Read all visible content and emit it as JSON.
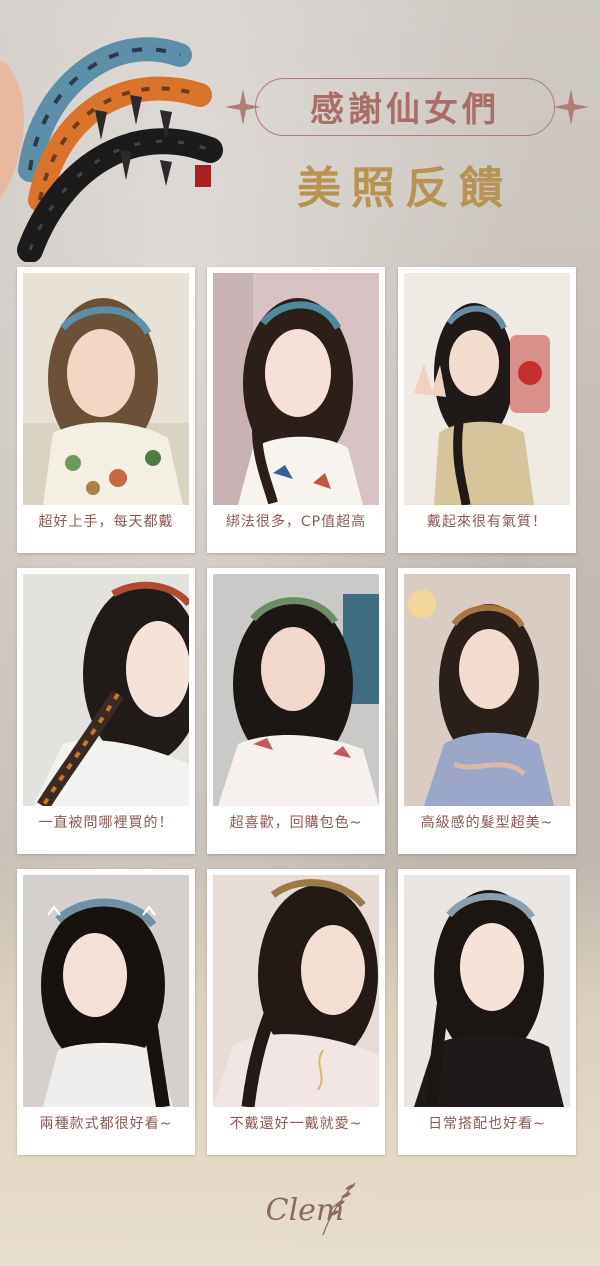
{
  "header": {
    "title_line1": "感謝仙女們",
    "title_line2": "美照反饋"
  },
  "colors": {
    "title_rose": "#a86f68",
    "title_gold": "#b89454",
    "caption": "#8a5a54"
  },
  "gallery": [
    {
      "caption": "超好上手，每天都戴"
    },
    {
      "caption": "綁法很多，CP值超高"
    },
    {
      "caption": "戴起來很有氣質！"
    },
    {
      "caption": "一直被問哪裡買的！"
    },
    {
      "caption": "超喜歡，回購包色~"
    },
    {
      "caption": "高級感的髮型超美~"
    },
    {
      "caption": "兩種款式都很好看~"
    },
    {
      "caption": "不戴還好一戴就愛~"
    },
    {
      "caption": "日常搭配也好看~"
    }
  ],
  "footer": {
    "logo_text": "Clem"
  }
}
